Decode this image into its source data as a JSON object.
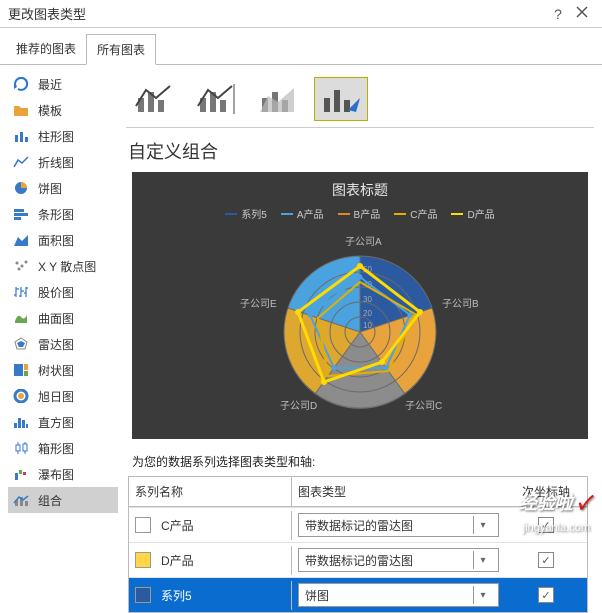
{
  "dialog": {
    "title": "更改图表类型",
    "help": "?",
    "close": "✕"
  },
  "tabs": {
    "recommended": "推荐的图表",
    "all": "所有图表"
  },
  "sidebar": {
    "items": [
      {
        "label": "最近"
      },
      {
        "label": "模板"
      },
      {
        "label": "柱形图"
      },
      {
        "label": "折线图"
      },
      {
        "label": "饼图"
      },
      {
        "label": "条形图"
      },
      {
        "label": "面积图"
      },
      {
        "label": "X Y 散点图"
      },
      {
        "label": "股价图"
      },
      {
        "label": "曲面图"
      },
      {
        "label": "雷达图"
      },
      {
        "label": "树状图"
      },
      {
        "label": "旭日图"
      },
      {
        "label": "直方图"
      },
      {
        "label": "箱形图"
      },
      {
        "label": "瀑布图"
      },
      {
        "label": "组合"
      }
    ]
  },
  "main": {
    "section_title": "自定义组合",
    "chart_title": "图表标题",
    "series_instructions": "为您的数据系列选择图表类型和轴:"
  },
  "legend": [
    {
      "name": "系列5",
      "color": "#2b5aa0"
    },
    {
      "name": "A产品",
      "color": "#4aa3df"
    },
    {
      "name": "B产品",
      "color": "#e08a1d"
    },
    {
      "name": "C产品",
      "color": "#e2b100"
    },
    {
      "name": "D产品",
      "color": "#ffdb00"
    }
  ],
  "radar_labels": {
    "a": "子公司A",
    "b": "子公司B",
    "c": "子公司C",
    "d": "子公司D",
    "e": "子公司E"
  },
  "series_table": {
    "col_name": "系列名称",
    "col_type": "图表类型",
    "col_axis": "次坐标轴",
    "rows": [
      {
        "name": "C产品",
        "type": "带数据标记的雷达图",
        "checked": true,
        "color": "#ffffff"
      },
      {
        "name": "D产品",
        "type": "带数据标记的雷达图",
        "checked": true,
        "color": "#ffd54a"
      },
      {
        "name": "系列5",
        "type": "饼图",
        "checked": true,
        "color": "#2b5aa0",
        "selected": true
      }
    ]
  },
  "watermark": {
    "text": "经验啦",
    "check": "✓",
    "sub": "jingyanla.com"
  },
  "chart_data": {
    "type": "radar",
    "title": "图表标题",
    "categories": [
      "子公司A",
      "子公司B",
      "子公司C",
      "子公司D",
      "子公司E"
    ],
    "series": [
      {
        "name": "系列5",
        "type": "pie",
        "values": [
          20,
          20,
          20,
          20,
          20
        ],
        "color": "#2b5aa0"
      },
      {
        "name": "A产品",
        "type": "radar",
        "values": [
          40,
          35,
          30,
          25,
          20
        ],
        "color": "#4aa3df"
      },
      {
        "name": "B产品",
        "type": "radar",
        "values": [
          35,
          40,
          30,
          35,
          30
        ],
        "color": "#e08a1d"
      },
      {
        "name": "C产品",
        "type": "radar",
        "values": [
          42,
          38,
          30,
          34,
          36
        ],
        "color": "#e2b100"
      },
      {
        "name": "D产品",
        "type": "radar",
        "values": [
          45,
          40,
          25,
          40,
          42
        ],
        "color": "#ffdb00"
      }
    ],
    "rlim": [
      0,
      50
    ],
    "ticks": [
      10,
      20,
      30,
      40,
      50
    ]
  }
}
